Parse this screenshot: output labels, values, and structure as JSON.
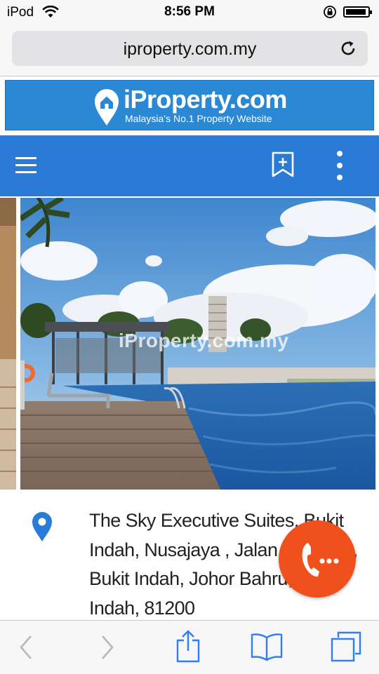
{
  "status_bar": {
    "carrier": "iPod",
    "time": "8:56 PM",
    "icons": [
      "wifi-icon",
      "rotation-lock-icon",
      "battery-icon"
    ]
  },
  "browser": {
    "url": "iproperty.com.my",
    "icons": [
      "reload-icon"
    ]
  },
  "banner": {
    "brand": "iProperty.com",
    "tagline": "Malaysia’s No.1 Property Website",
    "color": "#2b88d4",
    "icons": [
      "location-pin-logo-icon"
    ]
  },
  "nav": {
    "color": "#2a7bd6",
    "icons": [
      "hamburger-menu-icon",
      "bookmark-add-icon",
      "more-vertical-icon"
    ]
  },
  "listing": {
    "photo_watermark": "iProperty.com.my",
    "address": "The Sky Executive Suites, Bukit Indah, Nusajaya , Jalan Indah 15, Bukit Indah, Johor Bahru, Bukit Indah, 81200",
    "icons": [
      "location-marker-icon"
    ]
  },
  "fab": {
    "color": "#f0501c",
    "icons": [
      "phone-call-icon"
    ]
  },
  "toolbar": {
    "icons": [
      "back-icon",
      "forward-icon",
      "share-icon",
      "bookmarks-icon",
      "tabs-icon"
    ]
  }
}
